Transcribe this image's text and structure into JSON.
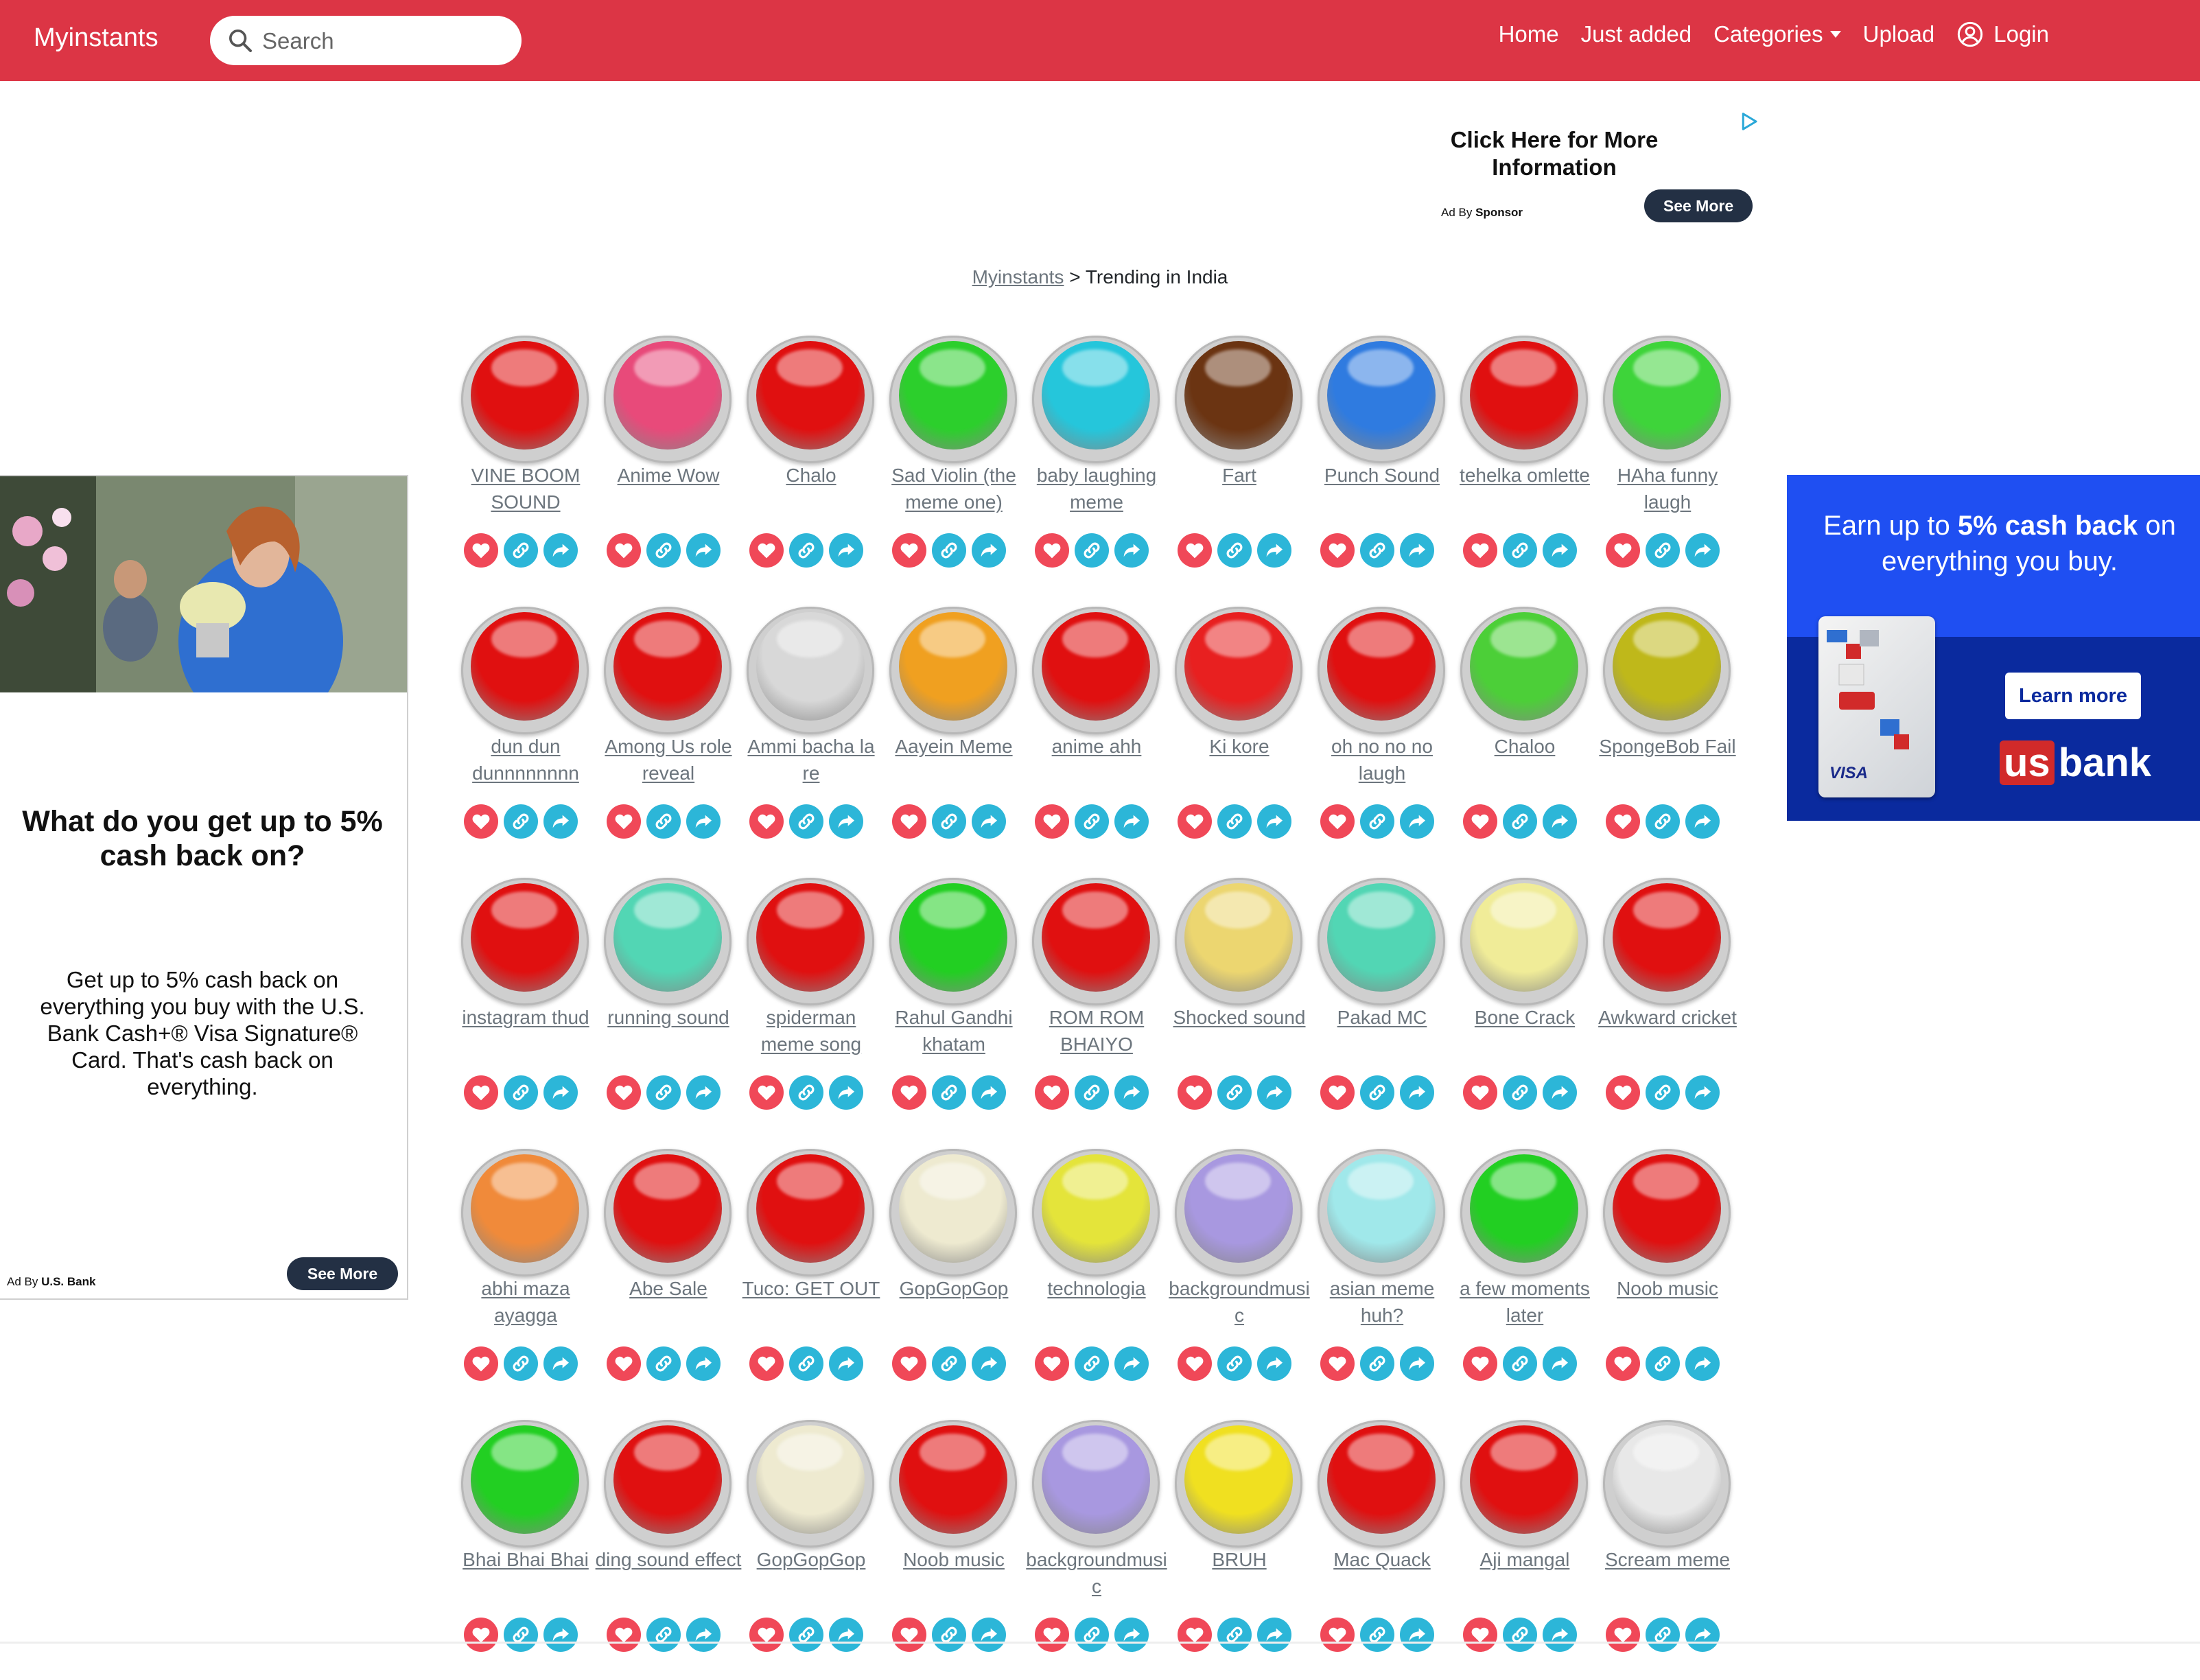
{
  "navbar": {
    "brand": "Myinstants",
    "search_placeholder": "Search",
    "links": {
      "home": "Home",
      "just_added": "Just added",
      "categories": "Categories",
      "upload": "Upload",
      "login": "Login"
    },
    "colors": {
      "background": "#dc3545",
      "text": "#ffffff"
    }
  },
  "top_ad": {
    "title": "Click Here for More Information",
    "ad_by_prefix": "Ad By",
    "ad_by_name": "Sponsor",
    "button": "See More"
  },
  "breadcrumb": {
    "root": "Myinstants",
    "separator": ">",
    "current": "Trending in India"
  },
  "left_ad": {
    "question": "What do you get up to 5% cash back on?",
    "body": "Get up to 5% cash back on everything you buy with the U.S. Bank Cash+® Visa Signature® Card. That's cash back on everything.",
    "ad_by_prefix": "Ad By",
    "ad_by_name": "U.S. Bank",
    "button": "See More"
  },
  "right_ad": {
    "headline_pre": "Earn up to",
    "headline_bold": "5% cash back",
    "headline_post": "on everything you buy.",
    "button": "Learn more",
    "logo_us": "us",
    "logo_bank": "bank"
  },
  "sounds": [
    {
      "label": "VINE BOOM SOUND",
      "color": "#e01010"
    },
    {
      "label": "Anime Wow",
      "color": "#e84a7a"
    },
    {
      "label": "Chalo",
      "color": "#e01010"
    },
    {
      "label": "Sad Violin (the meme one)",
      "color": "#2ccf2c"
    },
    {
      "label": "baby laughing meme",
      "color": "#25c6db"
    },
    {
      "label": "Fart",
      "color": "#6b3412"
    },
    {
      "label": "Punch Sound",
      "color": "#2f7be0"
    },
    {
      "label": "tehelka omlette",
      "color": "#e01010"
    },
    {
      "label": "HAha funny laugh",
      "color": "#3ed43a"
    },
    {
      "label": "dun dun dunnnnnnnn",
      "color": "#e01010"
    },
    {
      "label": "Among Us role reveal",
      "color": "#e01010"
    },
    {
      "label": "Ammi bacha la re",
      "color": "#d8d8d8"
    },
    {
      "label": "Aayein Meme",
      "color": "#f0a020"
    },
    {
      "label": "anime ahh",
      "color": "#e01010"
    },
    {
      "label": "Ki kore",
      "color": "#e82020"
    },
    {
      "label": "oh no no no laugh",
      "color": "#e01010"
    },
    {
      "label": "Chaloo",
      "color": "#4ccf38"
    },
    {
      "label": "SpongeBob Fail",
      "color": "#bfb81a"
    },
    {
      "label": "instagram thud",
      "color": "#e01010"
    },
    {
      "label": "running sound",
      "color": "#52d6b4"
    },
    {
      "label": "spiderman meme song",
      "color": "#e01010"
    },
    {
      "label": "Rahul Gandhi khatam",
      "color": "#22cf22"
    },
    {
      "label": "ROM ROM BHAIYO",
      "color": "#e01010"
    },
    {
      "label": "Shocked sound",
      "color": "#ecd670"
    },
    {
      "label": "Pakad MC",
      "color": "#52d6b4"
    },
    {
      "label": "Bone Crack",
      "color": "#f0ec98"
    },
    {
      "label": "Awkward cricket",
      "color": "#e01010"
    },
    {
      "label": "abhi maza ayagga",
      "color": "#f08a3a"
    },
    {
      "label": "Abe Sale",
      "color": "#e01010"
    },
    {
      "label": "Tuco: GET OUT",
      "color": "#e01010"
    },
    {
      "label": "GopGopGop",
      "color": "#eeead0"
    },
    {
      "label": "technologia",
      "color": "#e4e43a"
    },
    {
      "label": "backgroundmusic",
      "color": "#a898e0"
    },
    {
      "label": "asian meme huh?",
      "color": "#a0e8ea"
    },
    {
      "label": "a few moments later",
      "color": "#22cf22"
    },
    {
      "label": "Noob music",
      "color": "#e01010"
    },
    {
      "label": "Bhai Bhai Bhai",
      "color": "#22cf22"
    },
    {
      "label": "ding sound effect",
      "color": "#e01010"
    },
    {
      "label": "GopGopGop",
      "color": "#eeead0"
    },
    {
      "label": "Noob music",
      "color": "#e01010"
    },
    {
      "label": "backgroundmusic",
      "color": "#a898e0"
    },
    {
      "label": "BRUH",
      "color": "#f0e020"
    },
    {
      "label": "Mac Quack",
      "color": "#e01010"
    },
    {
      "label": "Aji mangal",
      "color": "#e01010"
    },
    {
      "label": "Scream meme",
      "color": "#e8e8e8"
    }
  ],
  "action_icons": {
    "favorite": "heart-icon",
    "copy_link": "link-icon",
    "share": "share-arrow-icon"
  },
  "colors": {
    "fav": "#f04858",
    "action": "#2cb6d8",
    "label": "#6c757d",
    "ad_dark": "#233044",
    "bank_blue": "#1f4ff2"
  }
}
